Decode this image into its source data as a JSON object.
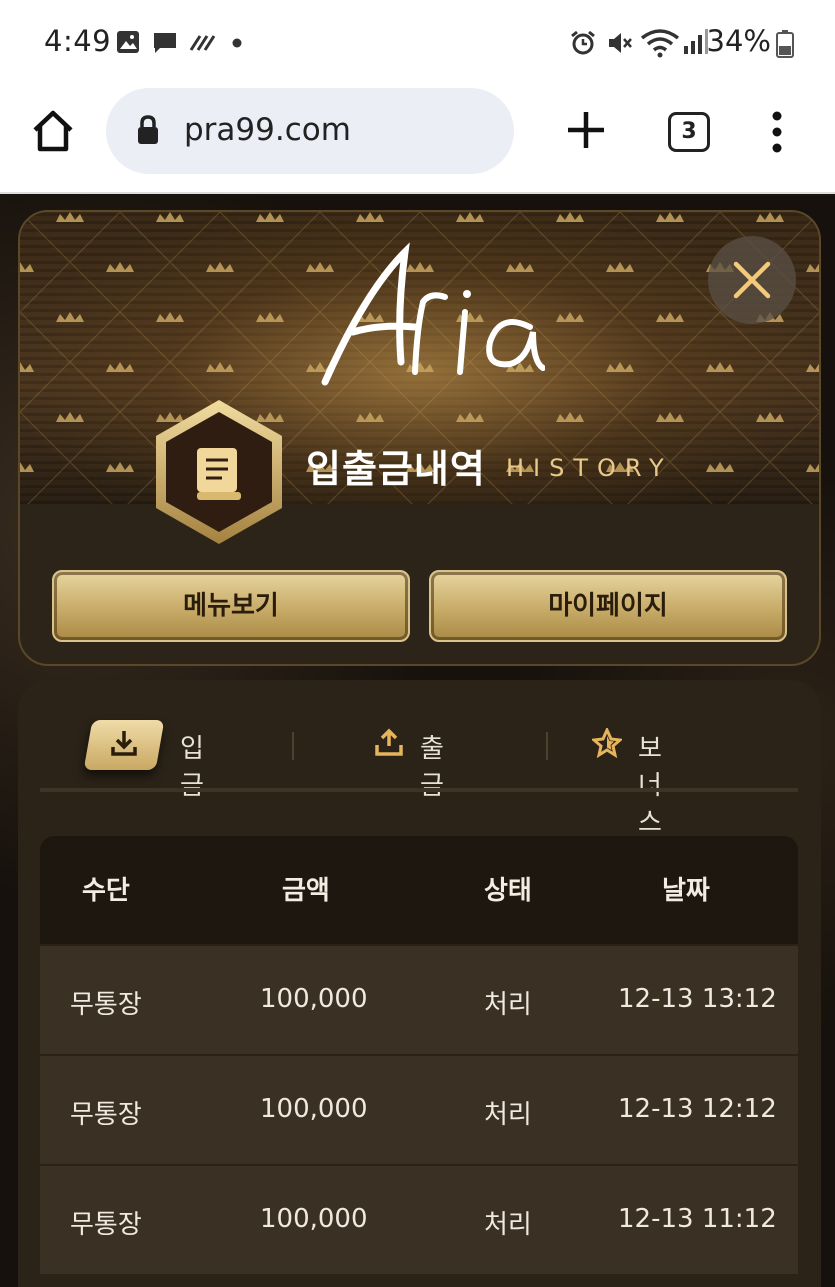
{
  "status_bar": {
    "time": "4:49",
    "battery": "34%",
    "icons": [
      "image-icon",
      "message-icon",
      "signal-dots-icon",
      "dot-icon",
      "alarm-icon",
      "mute-icon",
      "wifi-icon",
      "cell-signal-icon",
      "battery-icon"
    ]
  },
  "browser": {
    "url": "pra99.com",
    "tab_count": "3"
  },
  "modal": {
    "logo_text": "Aria",
    "title_ko": "입출금내역",
    "title_en": "HISTORY",
    "menu_button": "메뉴보기",
    "mypage_button": "마이페이지"
  },
  "tabs": [
    {
      "label": "입금",
      "icon": "download-icon",
      "active": true
    },
    {
      "label": "출금",
      "icon": "upload-icon",
      "active": false
    },
    {
      "label": "보너스내역",
      "icon": "star-icon",
      "active": false
    }
  ],
  "table": {
    "headers": [
      "수단",
      "금액",
      "상태",
      "날짜"
    ],
    "rows": [
      [
        "무통장",
        "100,000",
        "처리",
        "12-13 13:12"
      ],
      [
        "무통장",
        "100,000",
        "처리",
        "12-13 12:12"
      ],
      [
        "무통장",
        "100,000",
        "처리",
        "12-13 11:12"
      ]
    ]
  },
  "colors": {
    "gold": "#c9a863",
    "panel": "#2b2318",
    "header_row": "#1e170f",
    "row": "#3a3024"
  }
}
